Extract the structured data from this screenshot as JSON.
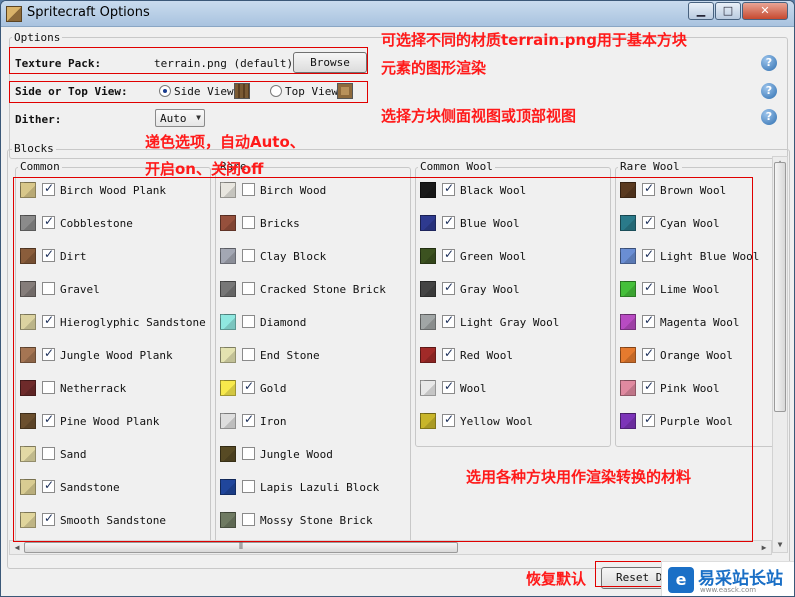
{
  "window": {
    "title": "Spritecraft Options"
  },
  "options": {
    "group_label": "Options",
    "texture_pack": {
      "label": "Texture Pack:",
      "value": "terrain.png (default)",
      "browse_label": "Browse"
    },
    "view": {
      "label": "Side or Top View:",
      "side_label": "Side View",
      "top_label": "Top View",
      "selected": "Side View"
    },
    "dither": {
      "label": "Dither:",
      "value": "Auto"
    }
  },
  "blocks": {
    "group_label": "Blocks",
    "columns": [
      {
        "title": "Common",
        "items": [
          {
            "name": "Birch Wood Plank",
            "checked": true,
            "color": "#d8c78a"
          },
          {
            "name": "Cobblestone",
            "checked": true,
            "color": "#8b8b8b"
          },
          {
            "name": "Dirt",
            "checked": true,
            "color": "#8a5d3b"
          },
          {
            "name": "Gravel",
            "checked": false,
            "color": "#857d7a"
          },
          {
            "name": "Hieroglyphic Sandstone",
            "checked": true,
            "color": "#dcd3a0"
          },
          {
            "name": "Jungle Wood Plank",
            "checked": true,
            "color": "#a57553"
          },
          {
            "name": "Netherrack",
            "checked": false,
            "color": "#6e2a2a"
          },
          {
            "name": "Pine Wood Plank",
            "checked": true,
            "color": "#6b4f2e"
          },
          {
            "name": "Sand",
            "checked": false,
            "color": "#e2d9a5"
          },
          {
            "name": "Sandstone",
            "checked": true,
            "color": "#d9cc92"
          },
          {
            "name": "Smooth Sandstone",
            "checked": true,
            "color": "#e0d59c"
          }
        ]
      },
      {
        "title": "Rare",
        "items": [
          {
            "name": "Birch Wood",
            "checked": false,
            "color": "#e8e6df"
          },
          {
            "name": "Bricks",
            "checked": false,
            "color": "#96503c"
          },
          {
            "name": "Clay Block",
            "checked": false,
            "color": "#a3a7b3"
          },
          {
            "name": "Cracked Stone Brick",
            "checked": false,
            "color": "#777777"
          },
          {
            "name": "Diamond",
            "checked": false,
            "color": "#8fe8e0"
          },
          {
            "name": "End Stone",
            "checked": false,
            "color": "#e3e2b0"
          },
          {
            "name": "Gold",
            "checked": true,
            "color": "#f7e94c"
          },
          {
            "name": "Iron",
            "checked": true,
            "color": "#dedede"
          },
          {
            "name": "Jungle Wood",
            "checked": false,
            "color": "#574a24"
          },
          {
            "name": "Lapis Lazuli Block",
            "checked": false,
            "color": "#20469c"
          },
          {
            "name": "Mossy Stone Brick",
            "checked": false,
            "color": "#6f7a62"
          }
        ]
      },
      {
        "title": "Common Wool",
        "items": [
          {
            "name": "Black Wool",
            "checked": true,
            "color": "#1a1a1a"
          },
          {
            "name": "Blue Wool",
            "checked": true,
            "color": "#2e3a8f"
          },
          {
            "name": "Green Wool",
            "checked": true,
            "color": "#3c5220"
          },
          {
            "name": "Gray Wool",
            "checked": true,
            "color": "#444444"
          },
          {
            "name": "Light Gray Wool",
            "checked": true,
            "color": "#a1a6a6"
          },
          {
            "name": "Red Wool",
            "checked": true,
            "color": "#a12a28"
          },
          {
            "name": "Wool",
            "checked": true,
            "color": "#e8e8e8"
          },
          {
            "name": "Yellow Wool",
            "checked": true,
            "color": "#c8b52a"
          }
        ]
      },
      {
        "title": "Rare Wool",
        "items": [
          {
            "name": "Brown Wool",
            "checked": true,
            "color": "#5a3a20"
          },
          {
            "name": "Cyan Wool",
            "checked": true,
            "color": "#2a7a8a"
          },
          {
            "name": "Light Blue Wool",
            "checked": true,
            "color": "#6a8ed4"
          },
          {
            "name": "Lime Wool",
            "checked": true,
            "color": "#45bf3a"
          },
          {
            "name": "Magenta Wool",
            "checked": true,
            "color": "#b84bc2"
          },
          {
            "name": "Orange Wool",
            "checked": true,
            "color": "#e57a2e"
          },
          {
            "name": "Pink Wool",
            "checked": true,
            "color": "#e08aa0"
          },
          {
            "name": "Purple Wool",
            "checked": true,
            "color": "#7c34b8"
          }
        ]
      }
    ]
  },
  "footer": {
    "reset_label": "Reset De"
  },
  "annotations": {
    "texture": "可选择不同的材质terrain.png用于基本方块",
    "texture_line2": "元素的图形渲染",
    "view": "选择方块侧面视图或顶部视图",
    "dither_line1": "递色选项，自动Auto、",
    "dither_line2": "开启on、关闭off",
    "blocks": "选用各种方块用作渲染转换的材料",
    "reset": "恢复默认"
  },
  "watermark": {
    "title": "易采站长站",
    "url": "www.easck.com"
  }
}
